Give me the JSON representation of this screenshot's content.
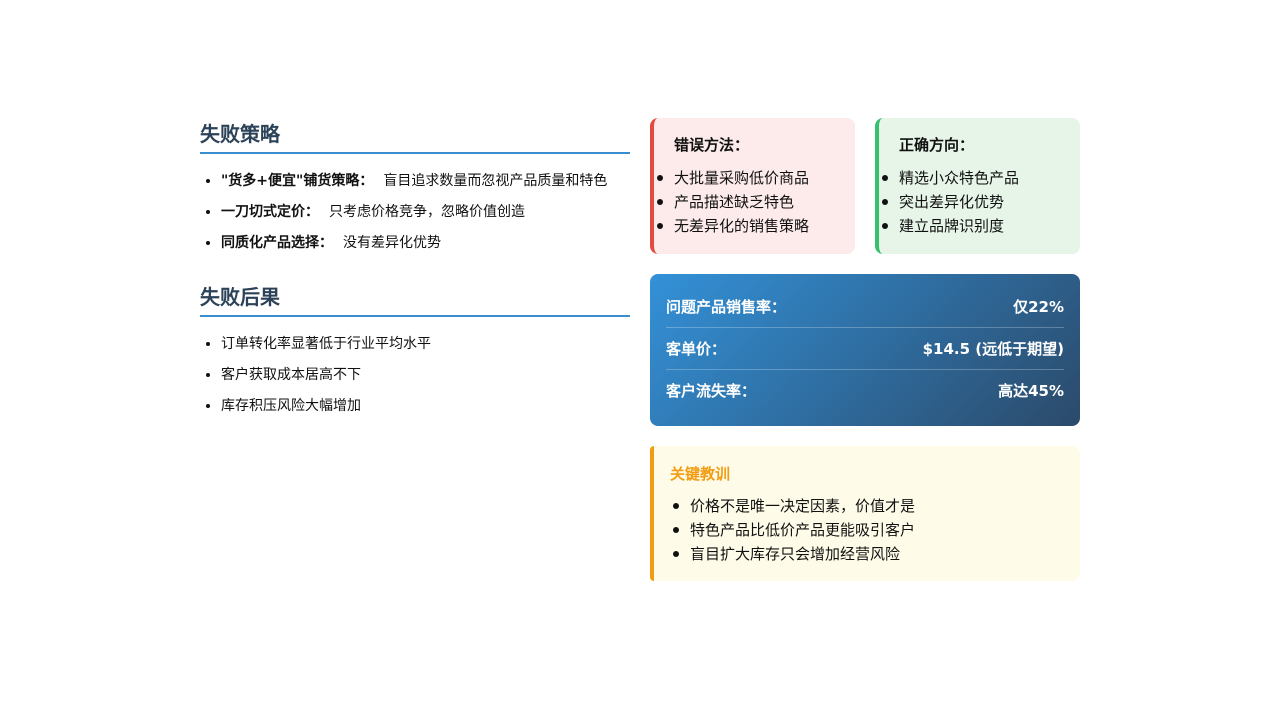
{
  "strategy": {
    "title": "失败策略",
    "items": [
      {
        "label": "\"货多+便宜\"铺货策略：",
        "text": "盲目追求数量而忽视产品质量和特色"
      },
      {
        "label": "一刀切式定价：",
        "text": "只考虑价格竞争，忽略价值创造"
      },
      {
        "label": "同质化产品选择：",
        "text": "没有差异化优势"
      }
    ]
  },
  "consequence": {
    "title": "失败后果",
    "items": [
      "订单转化率显著低于行业平均水平",
      "客户获取成本居高不下",
      "库存积压风险大幅增加"
    ]
  },
  "wrong_method": {
    "title": "错误方法：",
    "items": [
      "大批量采购低价商品",
      "产品描述缺乏特色",
      "无差异化的销售策略"
    ],
    "accent": "#e34b3f"
  },
  "right_direction": {
    "title": "正确方向：",
    "items": [
      "精选小众特色产品",
      "突出差异化优势",
      "建立品牌识别度"
    ],
    "accent": "#36c06b"
  },
  "stats": [
    {
      "label": "问题产品销售率：",
      "value": "仅22%"
    },
    {
      "label": "客单价：",
      "value": "$14.5 (远低于期望)"
    },
    {
      "label": "客户流失率：",
      "value": "高达45%"
    }
  ],
  "lesson": {
    "title": "关键教训",
    "items": [
      "价格不是唯一决定因素，价值才是",
      "特色产品比低价产品更能吸引客户",
      "盲目扩大库存只会增加经营风险"
    ],
    "accent": "#f39c12"
  }
}
